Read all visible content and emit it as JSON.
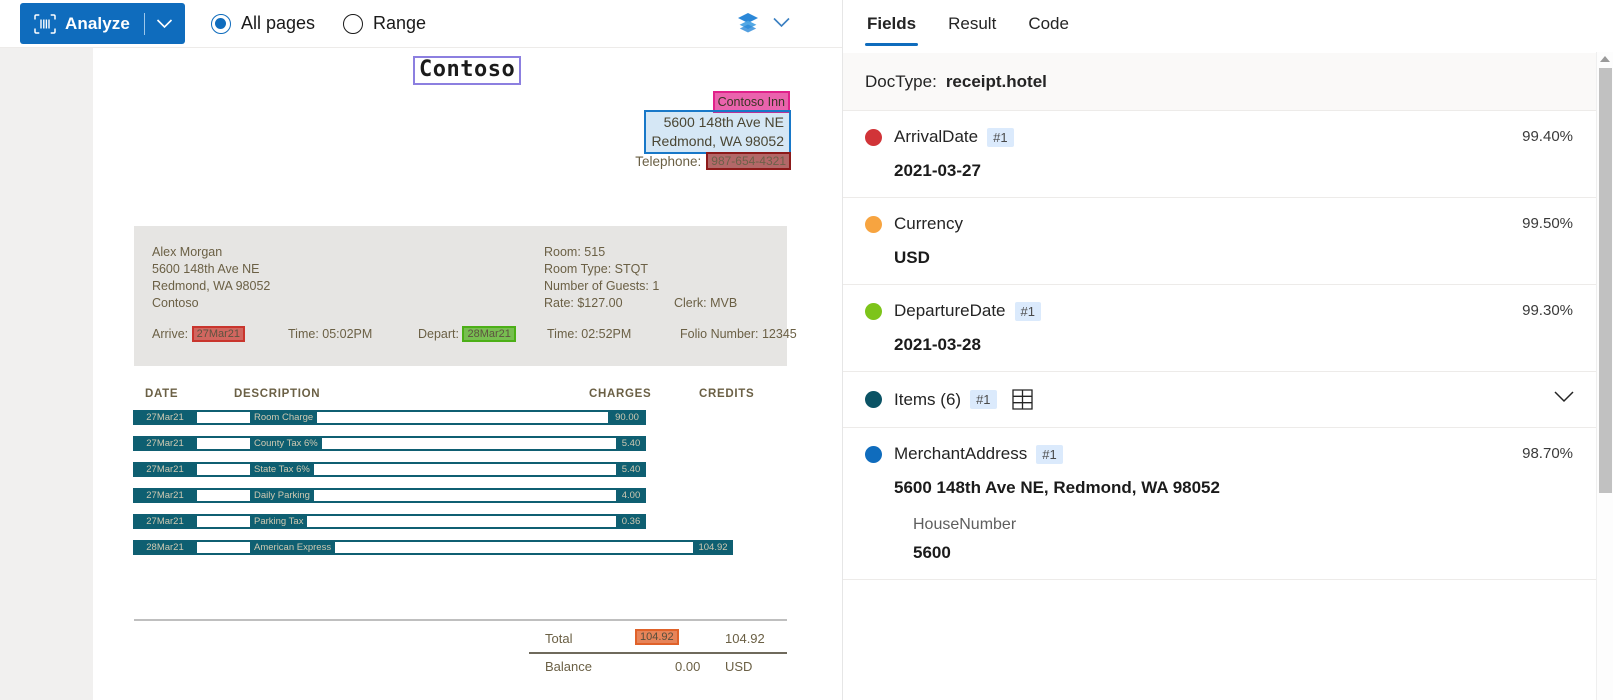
{
  "toolbar": {
    "analyze_label": "Analyze",
    "analyze_icon": "scan-icon",
    "split_chevron_icon": "chevron-down-icon",
    "options": [
      {
        "label": "All pages",
        "selected": true
      },
      {
        "label": "Range",
        "selected": false
      }
    ],
    "layers_icon": "layers-icon",
    "layers_chevron_icon": "chevron-down-icon"
  },
  "document": {
    "logo": "Contoso",
    "merchant_name": "Contoso Inn",
    "merchant_address_line1": "5600 148th Ave NE",
    "merchant_address_line2": "Redmond, WA 98052",
    "telephone_label": "Telephone:",
    "telephone_value": "987-654-4321",
    "guest": {
      "name": "Alex Morgan",
      "address_line1": "5600 148th Ave NE",
      "address_line2": "Redmond, WA 98052",
      "company": "Contoso",
      "room": "Room: 515",
      "room_type": "Room Type: STQT",
      "guests": "Number of Guests: 1",
      "rate": "Rate: $127.00",
      "clerk": "Clerk: MVB",
      "arrive_label": "Arrive:",
      "arrive_value": "27Mar21",
      "arrive_time": "Time: 05:02PM",
      "depart_label": "Depart:",
      "depart_value": "28Mar21",
      "depart_time": "Time: 02:52PM",
      "folio": "Folio Number: 12345"
    },
    "table": {
      "headers": [
        "DATE",
        "DESCRIPTION",
        "CHARGES",
        "CREDITS"
      ],
      "rows": [
        {
          "date": "27Mar21",
          "description": "Room Charge",
          "charges": "90.00",
          "credits": ""
        },
        {
          "date": "27Mar21",
          "description": "County Tax 6%",
          "charges": "5.40",
          "credits": ""
        },
        {
          "date": "27Mar21",
          "description": "State Tax 6%",
          "charges": "5.40",
          "credits": ""
        },
        {
          "date": "27Mar21",
          "description": "Daily Parking",
          "charges": "4.00",
          "credits": ""
        },
        {
          "date": "27Mar21",
          "description": "Parking Tax",
          "charges": "0.36",
          "credits": ""
        },
        {
          "date": "28Mar21",
          "description": "American Express",
          "charges": "104.92",
          "credits": ""
        }
      ]
    },
    "totals": {
      "total_label": "Total",
      "total_highlight": "104.92",
      "total_value": "104.92",
      "balance_label": "Balance",
      "balance_value": "0.00",
      "balance_currency": "USD"
    }
  },
  "panel": {
    "tabs": [
      {
        "label": "Fields",
        "active": true
      },
      {
        "label": "Result",
        "active": false
      },
      {
        "label": "Code",
        "active": false
      }
    ],
    "doctype_label": "DocType:",
    "doctype_value": "receipt.hotel",
    "fields": [
      {
        "name": "ArrivalDate",
        "badge": "#1",
        "confidence": "99.40%",
        "value": "2021-03-27",
        "color": "#d13438"
      },
      {
        "name": "Currency",
        "badge": "",
        "confidence": "99.50%",
        "value": "USD",
        "color": "#f7a440"
      },
      {
        "name": "DepartureDate",
        "badge": "#1",
        "confidence": "99.30%",
        "value": "2021-03-28",
        "color": "#7dc41a"
      },
      {
        "name": "Items (6)",
        "badge": "#1",
        "confidence": "",
        "value": "",
        "color": "#0b5365",
        "grid_icon": "table-grid-icon",
        "chevron_icon": "chevron-down-icon"
      },
      {
        "name": "MerchantAddress",
        "badge": "#1",
        "confidence": "98.70%",
        "value": "5600 148th Ave NE, Redmond, WA 98052",
        "color": "#0f6cbd",
        "sub_label": "HouseNumber",
        "sub_value": "5600"
      }
    ]
  }
}
